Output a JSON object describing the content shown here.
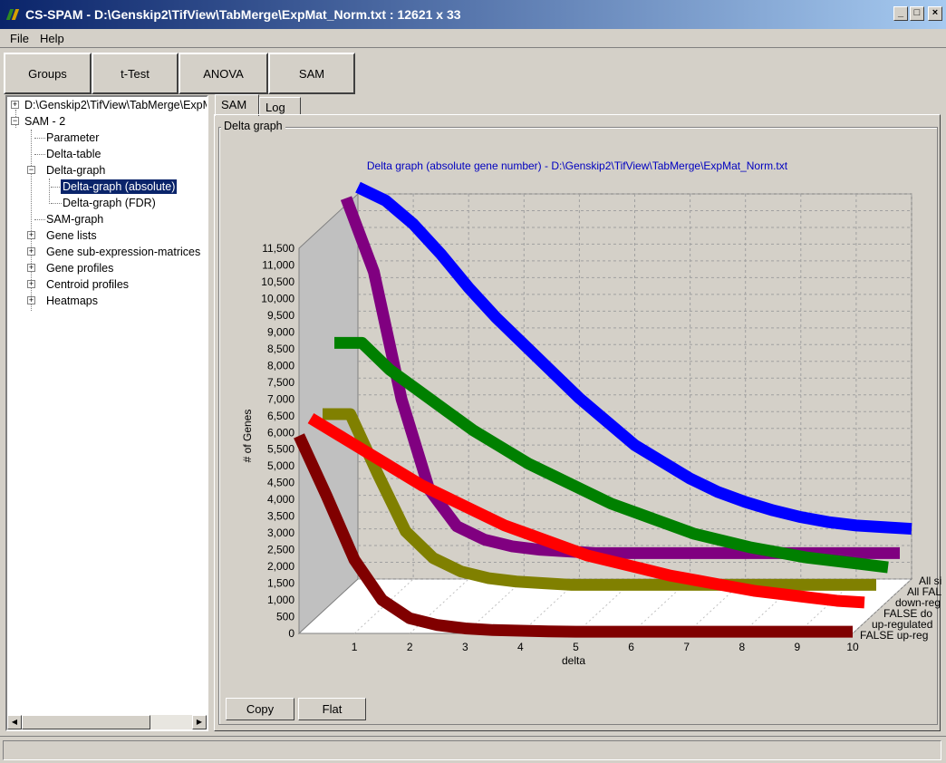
{
  "window": {
    "title": "CS-SPAM - D:\\Genskip2\\TifView\\TabMerge\\ExpMat_Norm.txt :  12621 x 33"
  },
  "menu": {
    "file": "File",
    "help": "Help"
  },
  "toolbar": {
    "groups": "Groups",
    "ttest": "t-Test",
    "anova": "ANOVA",
    "sam": "SAM"
  },
  "tree": {
    "root": "D:\\Genskip2\\TifView\\TabMerge\\ExpMat_Norm.txt",
    "sam": "SAM - 2",
    "parameter": "Parameter",
    "delta_table": "Delta-table",
    "delta_graph": "Delta-graph",
    "delta_graph_abs": "Delta-graph (absolute)",
    "delta_graph_fdr": "Delta-graph (FDR)",
    "sam_graph": "SAM-graph",
    "gene_lists": "Gene lists",
    "gene_sub": "Gene sub-expression-matrices",
    "gene_profiles": "Gene profiles",
    "centroid_profiles": "Centroid profiles",
    "heatmaps": "Heatmaps"
  },
  "tabs": {
    "sam": "SAM",
    "log": "Log"
  },
  "group_label": "Delta graph",
  "buttons": {
    "copy": "Copy",
    "flat": "Flat"
  },
  "chart_data": {
    "type": "line",
    "title": "Delta graph (absolute gene number) - D:\\Genskip2\\TifView\\TabMerge\\ExpMat_Norm.txt",
    "xlabel": "delta",
    "ylabel": "# of Genes",
    "x": [
      0,
      0.5,
      1,
      1.5,
      2,
      2.5,
      3,
      3.5,
      4,
      4.5,
      5,
      5.5,
      6,
      6.5,
      7,
      7.5,
      8,
      8.5,
      9,
      9.5,
      10
    ],
    "xlim": [
      0,
      10
    ],
    "ylim": [
      0,
      11500
    ],
    "yticks": [
      "0",
      "500",
      "1,000",
      "1,500",
      "2,000",
      "2,500",
      "3,000",
      "3,500",
      "4,000",
      "4,500",
      "5,000",
      "5,500",
      "6,000",
      "6,500",
      "7,000",
      "7,500",
      "8,000",
      "8,500",
      "9,000",
      "9,500",
      "10,000",
      "10,500",
      "11,000",
      "11,500"
    ],
    "xticks": [
      "1",
      "2",
      "3",
      "4",
      "5",
      "6",
      "7",
      "8",
      "9",
      "10"
    ],
    "series": [
      {
        "name": "All si",
        "color": "#0000ff",
        "values": [
          11700,
          11300,
          10600,
          9700,
          8700,
          7800,
          7000,
          6200,
          5400,
          4700,
          4000,
          3500,
          3000,
          2600,
          2300,
          2050,
          1850,
          1700,
          1600,
          1550,
          1500
        ]
      },
      {
        "name": "All FAL",
        "color": "#800080",
        "values": [
          11700,
          9500,
          5700,
          3000,
          1900,
          1500,
          1300,
          1200,
          1150,
          1100,
          1100,
          1100,
          1100,
          1100,
          1100,
          1100,
          1100,
          1100,
          1100,
          1100,
          1100
        ]
      },
      {
        "name": "down-reg",
        "color": "#008000",
        "values": [
          7700,
          7700,
          6900,
          6300,
          5700,
          5100,
          4600,
          4100,
          3700,
          3300,
          2900,
          2600,
          2300,
          2000,
          1800,
          1600,
          1450,
          1300,
          1200,
          1100,
          1000
        ]
      },
      {
        "name": "FALSE do",
        "color": "#808000",
        "values": [
          5900,
          5900,
          4100,
          2400,
          1600,
          1200,
          1000,
          900,
          850,
          800,
          800,
          800,
          800,
          800,
          800,
          800,
          800,
          800,
          800,
          800,
          800
        ]
      },
      {
        "name": "up-regulated",
        "color": "#ff0000",
        "values": [
          6100,
          5600,
          5100,
          4600,
          4100,
          3700,
          3300,
          2900,
          2600,
          2300,
          2000,
          1800,
          1600,
          1400,
          1250,
          1100,
          950,
          850,
          750,
          650,
          600
        ]
      },
      {
        "name": "FALSE up-reg",
        "color": "#800000",
        "values": [
          5900,
          4100,
          2200,
          1000,
          450,
          250,
          150,
          100,
          80,
          60,
          50,
          50,
          50,
          50,
          50,
          50,
          50,
          50,
          50,
          50,
          50
        ]
      }
    ],
    "grid": true,
    "legend": "right"
  }
}
